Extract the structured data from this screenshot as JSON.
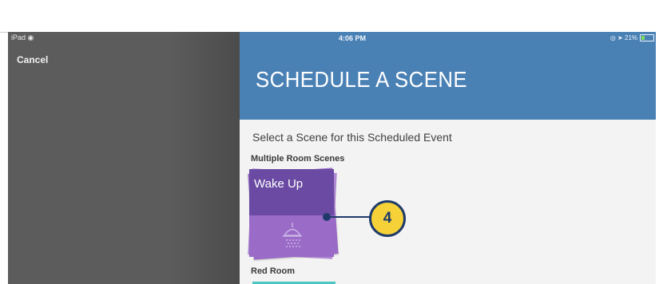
{
  "status_bar": {
    "device": "iPad ◉",
    "time": "4:06 PM",
    "right_indicators": "◎ ➤ 21%",
    "battery_level": 0.21
  },
  "left_panel": {
    "cancel_label": "Cancel"
  },
  "header": {
    "title": "SCHEDULE A SCENE",
    "color": "#4a81b5"
  },
  "content": {
    "subtitle": "Select a Scene for this Scheduled Event",
    "sections": [
      {
        "label": "Multiple Room Scenes",
        "scenes": [
          {
            "label": "Wake Up",
            "icon": "shower-icon",
            "color_top": "#6a4aa3",
            "color_bottom": "#9b6bc8"
          }
        ]
      },
      {
        "label": "Red Room",
        "accent": "#4ec6c4"
      }
    ]
  },
  "annotation": {
    "callout_number": "4",
    "callout_color": "#f6d238"
  }
}
